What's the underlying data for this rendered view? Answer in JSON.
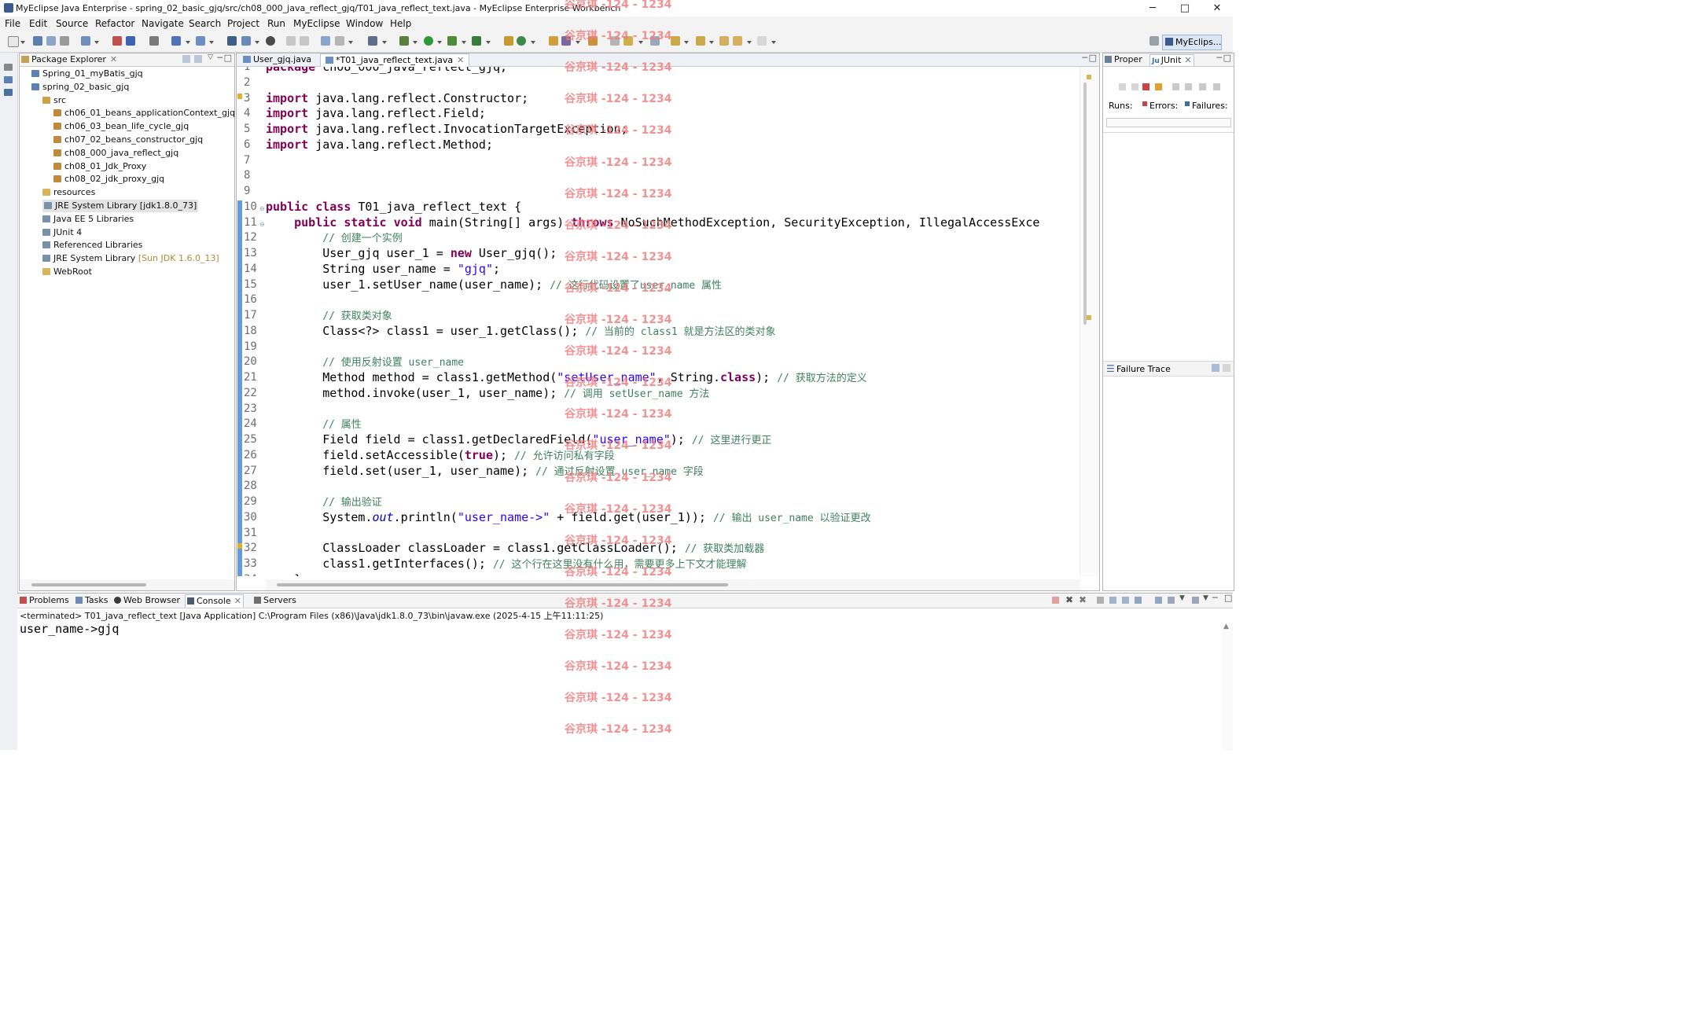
{
  "window": {
    "title": "MyEclipse Java Enterprise - spring_02_basic_gjq/src/ch08_000_java_reflect_gjq/T01_java_reflect_text.java - MyEclipse Enterprise Workbench",
    "minimize": "─",
    "maximize": "□",
    "close": "✕"
  },
  "menu": [
    "File",
    "Edit",
    "Source",
    "Refactor",
    "Navigate",
    "Search",
    "Project",
    "Run",
    "MyEclipse",
    "Window",
    "Help"
  ],
  "perspective": {
    "label": "MyEclips..."
  },
  "package_explorer": {
    "tab_label": "Package Explorer",
    "tree": [
      {
        "label": "Spring_01_myBatis_gjq",
        "decoration": "",
        "icon": "project-icon"
      },
      {
        "label": "spring_02_basic_gjq",
        "decoration": "",
        "icon": "project-icon"
      },
      {
        "label": "src",
        "decoration": "",
        "icon": "source-folder-icon"
      },
      {
        "label": "ch06_01_beans_applicationContext_gjq",
        "decoration": "",
        "icon": "package-icon"
      },
      {
        "label": "ch06_03_bean_life_cycle_gjq",
        "decoration": "",
        "icon": "package-icon"
      },
      {
        "label": "ch07_02_beans_constructor_gjq",
        "decoration": "",
        "icon": "package-icon"
      },
      {
        "label": "ch08_000_java_reflect_gjq",
        "decoration": "",
        "icon": "package-icon"
      },
      {
        "label": "ch08_01_Jdk_Proxy",
        "decoration": "",
        "icon": "package-icon"
      },
      {
        "label": "ch08_02_jdk_proxy_gjq",
        "decoration": "",
        "icon": "package-icon"
      },
      {
        "label": "resources",
        "decoration": "",
        "icon": "folder-icon"
      },
      {
        "label": "JRE System Library [jdk1.8.0_73]",
        "decoration": "",
        "icon": "library-icon"
      },
      {
        "label": "Java EE 5 Libraries",
        "decoration": "",
        "icon": "library-icon"
      },
      {
        "label": "JUnit 4",
        "decoration": "",
        "icon": "library-icon"
      },
      {
        "label": "Referenced Libraries",
        "decoration": "",
        "icon": "library-icon"
      },
      {
        "label": "JRE System Library",
        "decoration": "[Sun JDK 1.6.0_13]",
        "icon": "library-icon"
      },
      {
        "label": "WebRoot",
        "decoration": "",
        "icon": "folder-icon"
      }
    ]
  },
  "editor": {
    "tabs": [
      "User_gjq.java",
      "*T01_java_reflect_text.java"
    ],
    "line_numbers": [
      "1",
      "2",
      "3",
      "4",
      "5",
      "6",
      "7",
      "8",
      "9",
      "10",
      "11",
      "12",
      "13",
      "14",
      "15",
      "16",
      "17",
      "18",
      "19",
      "20",
      "21",
      "22",
      "23",
      "24",
      "25",
      "26",
      "27",
      "28",
      "29",
      "30",
      "31",
      "32",
      "33",
      "34"
    ],
    "lines": {
      "l1": [
        "package",
        " ch08_000_java_reflect_gjq;"
      ],
      "l3": [
        "import",
        " java.lang.reflect.Constructor;"
      ],
      "l4": [
        "import",
        " java.lang.reflect.Field;"
      ],
      "l5": [
        "import",
        " java.lang.reflect.InvocationTargetException;"
      ],
      "l6": [
        "import",
        " java.lang.reflect.Method;"
      ],
      "l10": [
        "public",
        " ",
        "class",
        " T01_java_reflect_text {"
      ],
      "l11": [
        "    ",
        "public",
        " ",
        "static",
        " ",
        "void",
        " main(String[] args) ",
        "throws",
        " NoSuchMethodException, SecurityException, IllegalAccessExce"
      ],
      "l12": [
        "        ",
        "// 创建一个实例"
      ],
      "l13": [
        "        User_gjq user_1 = ",
        "new",
        " User_gjq();"
      ],
      "l14": [
        "        String user_name = ",
        "\"gjq\"",
        ";"
      ],
      "l15": [
        "        user_1.setUser_name(user_name); ",
        "// 这行代码设置了user_name 属性"
      ],
      "l17": [
        "        ",
        "// 获取类对象"
      ],
      "l18": [
        "        Class<?> class1 = user_1.getClass(); ",
        "// 当前的 class1 就是方法区的类对象"
      ],
      "l20": [
        "        ",
        "// 使用反射设置 user_name"
      ],
      "l21": [
        "        Method method = class1.getMethod(",
        "\"setUser_name\"",
        ", String.",
        "class",
        "); ",
        "// 获取方法的定义"
      ],
      "l22": [
        "        method.invoke(user_1, user_name); ",
        "// 调用 setUser_name 方法"
      ],
      "l24": [
        "        ",
        "// 属性"
      ],
      "l25": [
        "        Field field = class1.getDeclaredField(",
        "\"user_name\"",
        "); ",
        "// 这里进行更正"
      ],
      "l26": [
        "        field.setAccessible(",
        "true",
        "); ",
        "// 允许访问私有字段"
      ],
      "l27": [
        "        field.set(user_1, user_name); ",
        "// 通过反射设置 user_name 字段"
      ],
      "l29": [
        "        ",
        "// 输出验证"
      ],
      "l30": [
        "        System.",
        "out",
        ".println(",
        "\"user_name->\"",
        " + field.get(user_1)); ",
        "// 输出 user_name 以验证更改"
      ],
      "l32": [
        "        ClassLoader classLoader = class1.getClassLoader(); ",
        "// 获取类加载器"
      ],
      "l33": [
        "        class1.getInterfaces(); ",
        "// 这个行在这里没有什么用，需要更多上下文才能理解"
      ],
      "l34": [
        "    }"
      ]
    }
  },
  "junit": {
    "tabs": [
      "Proper",
      "JUnit"
    ],
    "runs_label": "Runs:",
    "errors_label": "Errors:",
    "failures_label": "Failures:",
    "failure_trace_label": "Failure Trace"
  },
  "console": {
    "tabs": [
      "Problems",
      "Tasks",
      "Web Browser",
      "Console",
      "Servers"
    ],
    "status": "<terminated> T01_java_reflect_text [Java Application] C:\\Program Files (x86)\\Java\\jdk1.8.0_73\\bin\\javaw.exe (2025-4-15 上午11:11:25)",
    "output": "user_name->gjq"
  },
  "watermark": {
    "text": "谷京琪 -124 - 1234"
  },
  "colors": {
    "keyword": "#7f0055",
    "string": "#2a00ff",
    "comment": "#3f7f5f",
    "watermark": "#f08080",
    "fold_bar": "#4a88d6"
  }
}
